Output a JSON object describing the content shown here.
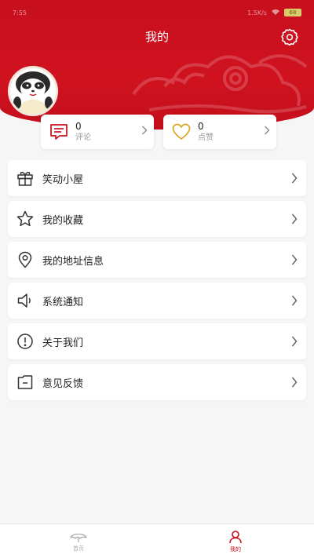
{
  "status_bar": {
    "time": "7:55",
    "speed": "1.5K/s",
    "battery": "68"
  },
  "header": {
    "title": "我的"
  },
  "stats": [
    {
      "count": "0",
      "label": "评论",
      "icon": "comment-icon"
    },
    {
      "count": "0",
      "label": "点赞",
      "icon": "heart-icon"
    }
  ],
  "menu": [
    {
      "label": "笑动小屋",
      "icon": "gift-icon"
    },
    {
      "label": "我的收藏",
      "icon": "star-icon"
    },
    {
      "label": "我的地址信息",
      "icon": "location-icon"
    },
    {
      "label": "系统通知",
      "icon": "speaker-icon"
    },
    {
      "label": "关于我们",
      "icon": "info-icon"
    },
    {
      "label": "意见反馈",
      "icon": "feedback-icon"
    }
  ],
  "tabbar": {
    "home_label": "首页",
    "mine_label": "我的"
  },
  "colors": {
    "brand_red": "#c70f1d",
    "heart_gold": "#d9a621",
    "icon_dark": "#333333"
  }
}
